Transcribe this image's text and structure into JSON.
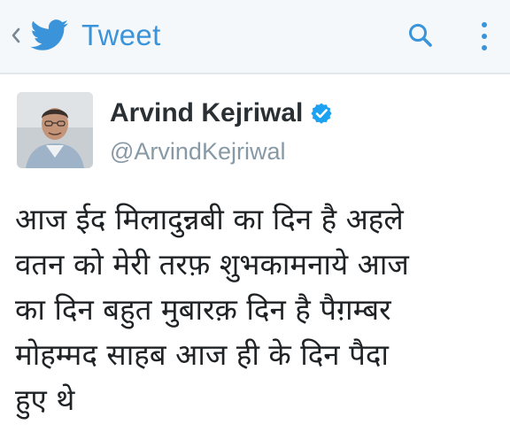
{
  "header": {
    "back_chevron": "‹",
    "back_icon": "chevron-left-icon",
    "logo_icon": "twitter-bird-icon",
    "title": "Tweet",
    "search_icon": "search-icon",
    "more_icon": "vertical-dots-icon"
  },
  "tweet": {
    "author": {
      "name": "Arvind Kejriwal",
      "handle": "@ArvindKejriwal",
      "verified": true,
      "verified_icon": "verified-badge-icon"
    },
    "text_lines": [
      "आज ईद मिलादुन्नबी का दिन है अहले",
      "वतन को मेरी तरफ़ शुभकामनाये आज",
      "का दिन बहुत मुबारक़ दिन है पैग़म्बर",
      "मोहम्मद साहब आज ही के दिन पैदा",
      "हुए थे"
    ]
  },
  "colors": {
    "brand_blue": "#3b94d9",
    "header_bg": "#f5f8fa",
    "divider": "#e1e8ed",
    "name_text": "#292f33",
    "handle_text": "#8899a6",
    "body_text": "#1f2326",
    "verified_blue": "#1da1f2",
    "icon_grey": "#8899a6"
  }
}
